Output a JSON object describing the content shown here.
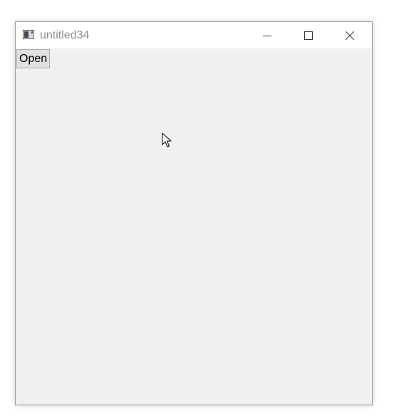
{
  "window": {
    "title": "untitled34",
    "icons": {
      "app": "app-window-icon",
      "minimize": "minimize-icon",
      "maximize": "maximize-icon",
      "close": "close-icon"
    }
  },
  "client": {
    "open_label": "Open"
  },
  "colors": {
    "client_background": "#f0f0f0",
    "titlebar_background": "#ffffff",
    "title_text": "#8e8e8e",
    "button_face": "#e1e1e1",
    "button_border": "#adadad"
  }
}
